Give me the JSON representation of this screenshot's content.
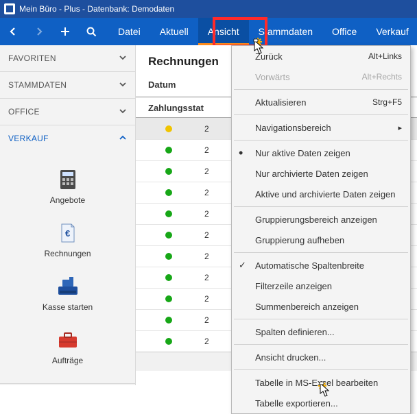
{
  "title": "Mein Büro - Plus - Datenbank: Demodaten",
  "menu": {
    "items": [
      "Datei",
      "Aktuell",
      "Ansicht",
      "Stammdaten",
      "Office",
      "Verkauf"
    ],
    "activeIndex": 2
  },
  "sidebar": {
    "sections": [
      {
        "label": "FAVORITEN",
        "open": false
      },
      {
        "label": "STAMMDATEN",
        "open": false
      },
      {
        "label": "OFFICE",
        "open": false
      },
      {
        "label": "VERKAUF",
        "open": true
      }
    ],
    "tiles": [
      {
        "label": "Angebote",
        "icon": "calculator"
      },
      {
        "label": "Rechnungen",
        "icon": "invoice"
      },
      {
        "label": "Kasse starten",
        "icon": "cashreg"
      },
      {
        "label": "Aufträge",
        "icon": "briefcase"
      }
    ]
  },
  "content": {
    "heading": "Rechnungen",
    "dateLabel": "Datum",
    "statusHeader": "Zahlungsstat",
    "rows": [
      {
        "status": "y",
        "selected": true,
        "datePartial": "2"
      },
      {
        "status": "g",
        "datePartial": "2"
      },
      {
        "status": "g",
        "datePartial": "2"
      },
      {
        "status": "g",
        "datePartial": "2"
      },
      {
        "status": "g",
        "datePartial": "2"
      },
      {
        "status": "g",
        "datePartial": "2"
      },
      {
        "status": "g",
        "datePartial": "2"
      },
      {
        "status": "g",
        "datePartial": "2"
      },
      {
        "status": "g",
        "datePartial": "2"
      },
      {
        "status": "g",
        "datePartial": "2"
      },
      {
        "status": "g",
        "datePartial": "2"
      }
    ]
  },
  "dropdown": {
    "items": [
      {
        "label": "Zurück",
        "shortcut": "Alt+Links"
      },
      {
        "label": "Vorwärts",
        "shortcut": "Alt+Rechts",
        "disabled": true
      },
      {
        "sep": true
      },
      {
        "label": "Aktualisieren",
        "shortcut": "Strg+F5"
      },
      {
        "sep": true
      },
      {
        "label": "Navigationsbereich",
        "submenu": true
      },
      {
        "sep": true
      },
      {
        "label": "Nur aktive Daten zeigen",
        "radio": true
      },
      {
        "label": "Nur archivierte Daten zeigen"
      },
      {
        "label": "Aktive und archivierte Daten zeigen"
      },
      {
        "sep": true
      },
      {
        "label": "Gruppierungsbereich anzeigen"
      },
      {
        "label": "Gruppierung aufheben"
      },
      {
        "sep": true
      },
      {
        "label": "Automatische Spaltenbreite",
        "check": true
      },
      {
        "label": "Filterzeile anzeigen"
      },
      {
        "label": "Summenbereich anzeigen"
      },
      {
        "sep": true
      },
      {
        "label": "Spalten definieren..."
      },
      {
        "sep": true
      },
      {
        "label": "Ansicht drucken..."
      },
      {
        "sep": true
      },
      {
        "label": "Tabelle in MS-Excel bearbeiten"
      },
      {
        "label": "Tabelle exportieren..."
      }
    ]
  }
}
